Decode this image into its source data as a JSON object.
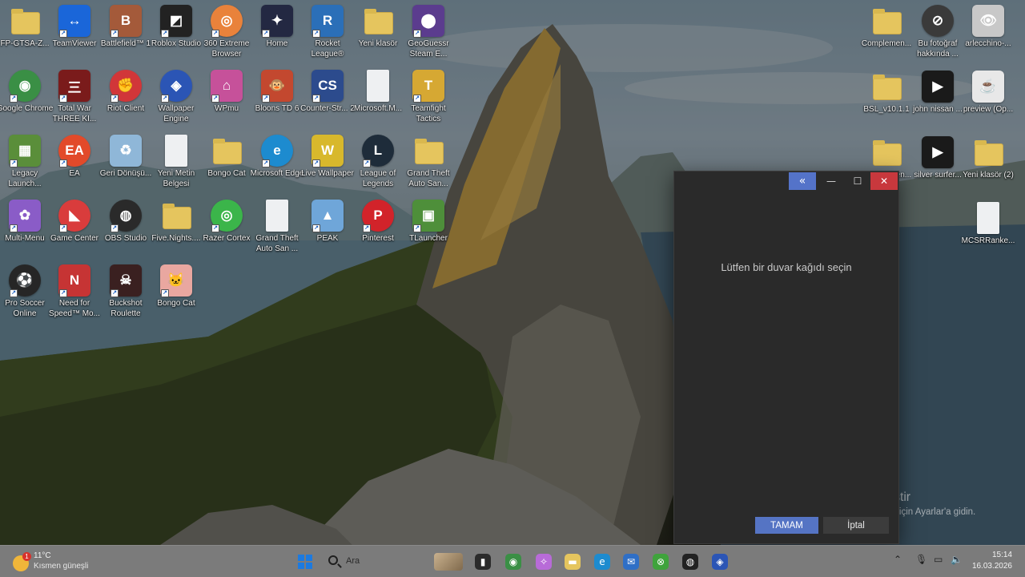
{
  "desktop_icons": [
    {
      "label": "FP-GTSA-Z...",
      "icon": "folder-icon",
      "bg": "folder"
    },
    {
      "label": "TeamViewer",
      "icon": "teamviewer-icon",
      "bg": "#1a66d9",
      "glyph": "↔",
      "shortcut": true
    },
    {
      "label": "Battlefield™ 1",
      "icon": "battlefield-icon",
      "bg": "#a45a3a",
      "glyph": "B",
      "shortcut": true
    },
    {
      "label": "Roblox Studio",
      "icon": "roblox-studio-icon",
      "bg": "#222222",
      "glyph": "◩",
      "shortcut": true
    },
    {
      "label": "360 Extreme Browser",
      "icon": "browser-360-icon",
      "bg": "#e9823b",
      "glyph": "◎",
      "shortcut": true,
      "round": true
    },
    {
      "label": "Home",
      "icon": "home-app-icon",
      "bg": "#232842",
      "glyph": "✦",
      "shortcut": true
    },
    {
      "label": "Rocket League®",
      "icon": "rocket-league-icon",
      "bg": "#2b6fb8",
      "glyph": "R",
      "shortcut": true
    },
    {
      "label": "Yeni klasör",
      "icon": "folder-icon",
      "bg": "folder"
    },
    {
      "label": "GeoGuessr Steam E...",
      "icon": "geoguessr-icon",
      "bg": "#5b3c8e",
      "glyph": "⬤",
      "shortcut": true
    },
    {
      "label": "Google Chrome",
      "icon": "chrome-icon",
      "bg": "#3a8f45",
      "glyph": "◉",
      "shortcut": true,
      "round": true
    },
    {
      "label": "Total War THREE KI...",
      "icon": "total-war-icon",
      "bg": "#7a1b1b",
      "glyph": "三",
      "shortcut": true
    },
    {
      "label": "Riot Client",
      "icon": "riot-client-icon",
      "bg": "#d13639",
      "glyph": "✊",
      "shortcut": true,
      "round": true
    },
    {
      "label": "Wallpaper Engine",
      "icon": "wallpaper-engine-icon",
      "bg": "#2b55b5",
      "glyph": "◈",
      "shortcut": true,
      "round": true
    },
    {
      "label": "WPmu",
      "icon": "wpmu-icon",
      "bg": "#c6519a",
      "glyph": "⌂",
      "shortcut": true
    },
    {
      "label": "Bloons TD 6",
      "icon": "bloons-icon",
      "bg": "#c3482f",
      "glyph": "🐵",
      "shortcut": true
    },
    {
      "label": "Counter-Str... 2",
      "icon": "counter-strike-icon",
      "bg": "#2c4b8d",
      "glyph": "CS",
      "shortcut": true
    },
    {
      "label": "Microsoft.M...",
      "icon": "file-icon",
      "bg": "file"
    },
    {
      "label": "Teamfight Tactics",
      "icon": "tft-icon",
      "bg": "#d6a833",
      "glyph": "T",
      "shortcut": true
    },
    {
      "label": "Legacy Launch...",
      "icon": "minecraft-icon",
      "bg": "#5a8e3a",
      "glyph": "▦",
      "shortcut": true
    },
    {
      "label": "EA",
      "icon": "ea-icon",
      "bg": "#e24a2a",
      "glyph": "EA",
      "shortcut": true,
      "round": true
    },
    {
      "label": "Geri Dönüşü...",
      "icon": "recycle-bin-icon",
      "bg": "#8fb7d8",
      "glyph": "♻"
    },
    {
      "label": "Yeni Metin Belgesi",
      "icon": "file-icon",
      "bg": "file"
    },
    {
      "label": "Bongo Cat",
      "icon": "folder-icon",
      "bg": "folder"
    },
    {
      "label": "Microsoft Edge",
      "icon": "edge-icon",
      "bg": "#1d8bcf",
      "glyph": "e",
      "shortcut": true,
      "round": true
    },
    {
      "label": "Live Wallpaper",
      "icon": "live-wallpaper-icon",
      "bg": "#d8b82c",
      "glyph": "W",
      "shortcut": true
    },
    {
      "label": "League of Legends",
      "icon": "league-icon",
      "bg": "#1e2c3a",
      "glyph": "L",
      "shortcut": true,
      "round": true
    },
    {
      "label": "Grand Theft Auto San...",
      "icon": "folder-icon",
      "bg": "folder"
    },
    {
      "label": "Multi-Menu",
      "icon": "multi-menu-icon",
      "bg": "#8a5cc7",
      "glyph": "✿",
      "shortcut": true
    },
    {
      "label": "Game Center",
      "icon": "game-center-icon",
      "bg": "#d93c3c",
      "glyph": "◣",
      "shortcut": true,
      "round": true
    },
    {
      "label": "OBS Studio",
      "icon": "obs-icon",
      "bg": "#2a2a2a",
      "glyph": "◍",
      "shortcut": true,
      "round": true
    },
    {
      "label": "Five.Nights....",
      "icon": "folder-icon",
      "bg": "folder"
    },
    {
      "label": "Razer Cortex",
      "icon": "razer-cortex-icon",
      "bg": "#3bb54a",
      "glyph": "◎",
      "shortcut": true,
      "round": true
    },
    {
      "label": "Grand Theft Auto San ...",
      "icon": "file-icon",
      "bg": "file"
    },
    {
      "label": "PEAK",
      "icon": "peak-icon",
      "bg": "#6fa6d9",
      "glyph": "▲",
      "shortcut": true
    },
    {
      "label": "Pinterest",
      "icon": "pinterest-icon",
      "bg": "#d2232a",
      "glyph": "P",
      "shortcut": true,
      "round": true
    },
    {
      "label": "TLauncher",
      "icon": "tlauncher-icon",
      "bg": "#4e8f3a",
      "glyph": "▣",
      "shortcut": true
    },
    {
      "label": "Pro Soccer Online",
      "icon": "pro-soccer-icon",
      "bg": "#262626",
      "glyph": "⚽",
      "shortcut": true,
      "round": true
    },
    {
      "label": "Need for Speed™ Mo...",
      "icon": "nfs-icon",
      "bg": "#c63434",
      "glyph": "N",
      "shortcut": true
    },
    {
      "label": "Buckshot Roulette",
      "icon": "buckshot-icon",
      "bg": "#3a2020",
      "glyph": "☠",
      "shortcut": true
    },
    {
      "label": "Bongo Cat",
      "icon": "bongo-cat-icon",
      "bg": "#e9a7a0",
      "glyph": "🐱",
      "shortcut": true
    }
  ],
  "right_icons": [
    {
      "label": "Complemen...",
      "icon": "folder-icon",
      "bg": "folder"
    },
    {
      "label": "Bu fotoğraf hakkında ...",
      "icon": "info-photo-icon",
      "bg": "#3a3a3a",
      "glyph": "⊘",
      "round": true
    },
    {
      "label": "arlecchino-...",
      "icon": "image-file-icon",
      "bg": "#c8c8c8",
      "glyph": "👁"
    },
    {
      "label": "BSL_v10.1.1",
      "icon": "folder-icon",
      "bg": "folder"
    },
    {
      "label": "john nissan ...",
      "icon": "video-file-icon",
      "bg": "#1a1a1a",
      "glyph": "▶"
    },
    {
      "label": "preview (Op...",
      "icon": "java-file-icon",
      "bg": "#e8e8e8",
      "glyph": "☕"
    },
    {
      "label": "Complemen...",
      "icon": "folder-icon",
      "bg": "folder"
    },
    {
      "label": "silver surfer...",
      "icon": "video-file-icon",
      "bg": "#1a1a1a",
      "glyph": "▶"
    },
    {
      "label": "Yeni klasör (2)",
      "icon": "folder-icon",
      "bg": "folder"
    },
    {
      "label": "MCSRRanke...",
      "icon": "file-icon",
      "bg": "file"
    }
  ],
  "dialog": {
    "message": "Lütfen bir duvar kağıdı seçin",
    "ok_label": "TAMAM",
    "cancel_label": "İptal",
    "back_glyph": "«",
    "min_glyph": "—",
    "max_glyph": "☐",
    "close_glyph": "✕"
  },
  "activation": {
    "title": "Windows'u Etkinleştir",
    "subtitle": "Windows'u etkinleştirmek için Ayarlar'a gidin."
  },
  "taskbar": {
    "weather_temp": "11°C",
    "weather_desc": "Kısmen güneşli",
    "weather_badge": "1",
    "search_placeholder": "Ara",
    "apps": [
      {
        "icon": "file-explorer-dark-icon",
        "bg": "#2b2b2b",
        "glyph": "▮"
      },
      {
        "icon": "chrome-icon",
        "bg": "#3a8f45",
        "glyph": "◉"
      },
      {
        "icon": "copilot-icon",
        "bg": "#b86bd8",
        "glyph": "✧"
      },
      {
        "icon": "file-explorer-icon",
        "bg": "#e5c55e",
        "glyph": "▬"
      },
      {
        "icon": "edge-icon",
        "bg": "#1d8bcf",
        "glyph": "e"
      },
      {
        "icon": "mail-icon",
        "bg": "#2f6fc6",
        "glyph": "✉"
      },
      {
        "icon": "xbox-icon",
        "bg": "#3fa33c",
        "glyph": "⊗"
      },
      {
        "icon": "obs-icon",
        "bg": "#222222",
        "glyph": "◍"
      },
      {
        "icon": "wallpaper-engine-icon",
        "bg": "#2b55b5",
        "glyph": "◈"
      }
    ],
    "time": "15:14",
    "date": "16.03.2026"
  }
}
